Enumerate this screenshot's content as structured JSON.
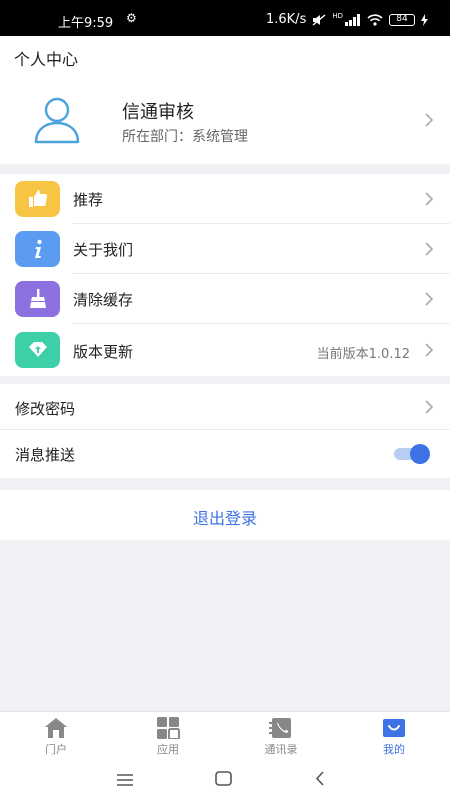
{
  "status_bar": {
    "time": "上午9:59",
    "network_speed": "1.6K/s",
    "network_type": "HD",
    "battery_level": "84"
  },
  "header": {
    "title": "个人中心"
  },
  "profile": {
    "name": "信通审核",
    "department": "所在部门：系统管理"
  },
  "menu": {
    "items": [
      {
        "label": "推荐",
        "icon": "thumbs-up-icon",
        "color": "#f7c444"
      },
      {
        "label": "关于我们",
        "icon": "info-icon",
        "color": "#5b9cf2"
      },
      {
        "label": "清除缓存",
        "icon": "broom-icon",
        "color": "#8d70e0"
      },
      {
        "label": "版本更新",
        "icon": "update-gem-icon",
        "color": "#3ccfa8",
        "value": "当前版本1.0.12"
      }
    ]
  },
  "settings": {
    "change_password": "修改密码",
    "push_notifications": "消息推送",
    "push_enabled": true
  },
  "logout_label": "退出登录",
  "tabs": [
    {
      "label": "门户",
      "icon": "home-icon",
      "active": false
    },
    {
      "label": "应用",
      "icon": "apps-grid-icon",
      "active": false
    },
    {
      "label": "通讯录",
      "icon": "contacts-book-icon",
      "active": false
    },
    {
      "label": "我的",
      "icon": "profile-icon",
      "active": true
    }
  ],
  "colors": {
    "accent": "#3f72e4",
    "inactive_tab": "#888888",
    "background": "#eff1f4"
  }
}
